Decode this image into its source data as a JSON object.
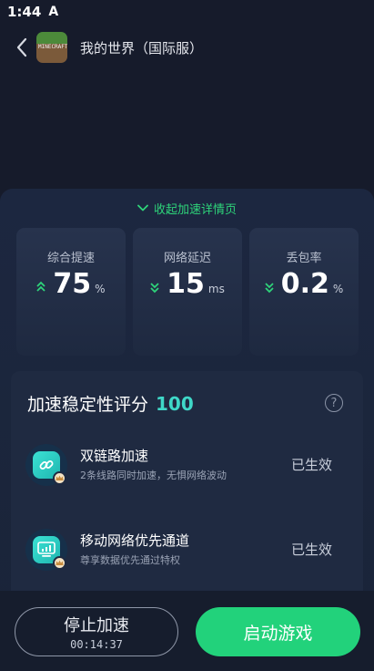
{
  "status_bar": {
    "time": "1:44",
    "notification_glyph": "A"
  },
  "header": {
    "title": "我的世界（国际服）",
    "game_icon_text": "MINECRAFT",
    "back_icon": "chevron-left-icon"
  },
  "panel": {
    "collapse_label": "收起加速详情页",
    "stats": [
      {
        "label": "综合提速",
        "value": "75",
        "unit": "%",
        "direction": "up"
      },
      {
        "label": "网络延迟",
        "value": "15",
        "unit": "ms",
        "direction": "down"
      },
      {
        "label": "丢包率",
        "value": "0.2",
        "unit": "%",
        "direction": "down"
      }
    ]
  },
  "stability": {
    "title": "加速稳定性评分",
    "score": "100",
    "help_glyph": "?",
    "features": [
      {
        "title": "双链路加速",
        "desc": "2条线路同时加速，无惧网络波动",
        "status": "已生效",
        "icon": "link-icon"
      },
      {
        "title": "移动网络优先通道",
        "desc": "尊享数据优先通过特权",
        "status": "已生效",
        "icon": "signal-chart-icon"
      }
    ]
  },
  "actions": {
    "stop_label": "停止加速",
    "elapsed": "00:14:37",
    "launch_label": "启动游戏"
  },
  "colors": {
    "accent_green": "#22d27b",
    "score_cyan": "#3fd8c8",
    "background": "#161b2b"
  }
}
